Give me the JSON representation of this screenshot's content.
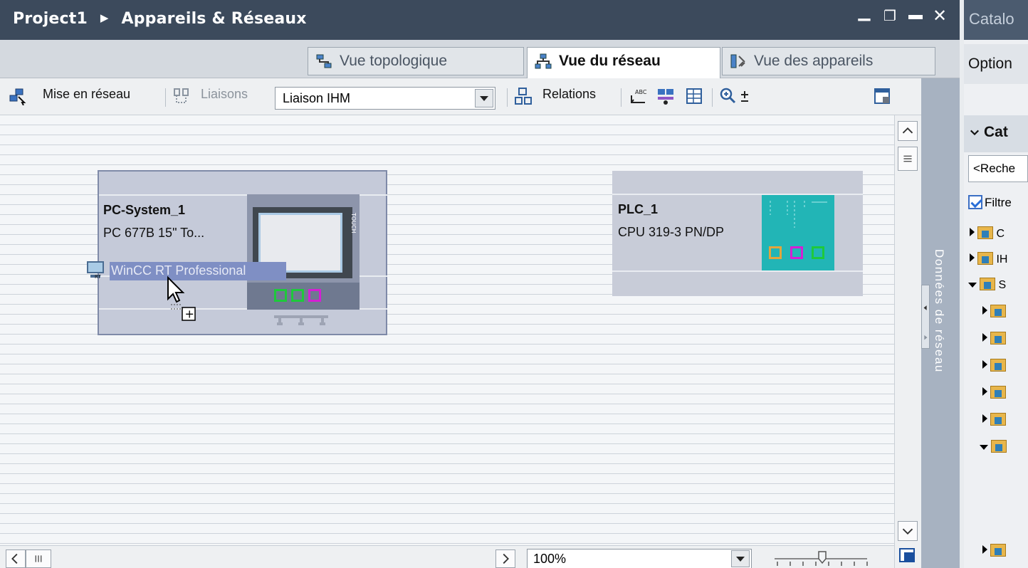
{
  "window": {
    "title_project": "Project1",
    "title_section": "Appareils & Réseaux",
    "breadcrumb_separator": "▶",
    "minimize_glyph": "▁",
    "restore_glyph": "❐",
    "maximize_glyph": "▬",
    "close_glyph": "✕"
  },
  "tabs": [
    {
      "label": "Vue topologique",
      "icon": "topology-icon",
      "active": false
    },
    {
      "label": "Vue du réseau",
      "icon": "network-icon",
      "active": true
    },
    {
      "label": "Vue des appareils",
      "icon": "devices-icon",
      "active": false
    }
  ],
  "toolbar": {
    "networking_label": "Mise en réseau",
    "connections_label": "Liaisons",
    "connection_type_value": "Liaison IHM",
    "relations_label": "Relations"
  },
  "devices": [
    {
      "name": "PC-System_1",
      "type": "PC 677B 15\" To...",
      "touch_label": "TOUCH"
    },
    {
      "name": "PLC_1",
      "type": "CPU 319-3 PN/DP"
    }
  ],
  "drag": {
    "item_label": "WinCC RT Professional",
    "copy_glyph": "+"
  },
  "side_panel": {
    "label": "Données de réseau"
  },
  "zoom": {
    "value": "100%"
  },
  "catalog": {
    "title": "Catalo",
    "options_label": "Option",
    "section_label": "Cat",
    "search_placeholder": "<Reche",
    "filter_label": "Filtre",
    "filter_checked": true,
    "tree": [
      {
        "label": "C",
        "expanded": false
      },
      {
        "label": "IH",
        "expanded": false
      },
      {
        "label": "S",
        "expanded": true
      }
    ]
  },
  "colors": {
    "title_bar": "#3c4a5c",
    "port_green": "#1ec93b",
    "port_magenta": "#d41fd4",
    "port_orange": "#e3a53c",
    "plc_body": "#22b5b6",
    "drag_highlight": "#7f8fc4"
  }
}
